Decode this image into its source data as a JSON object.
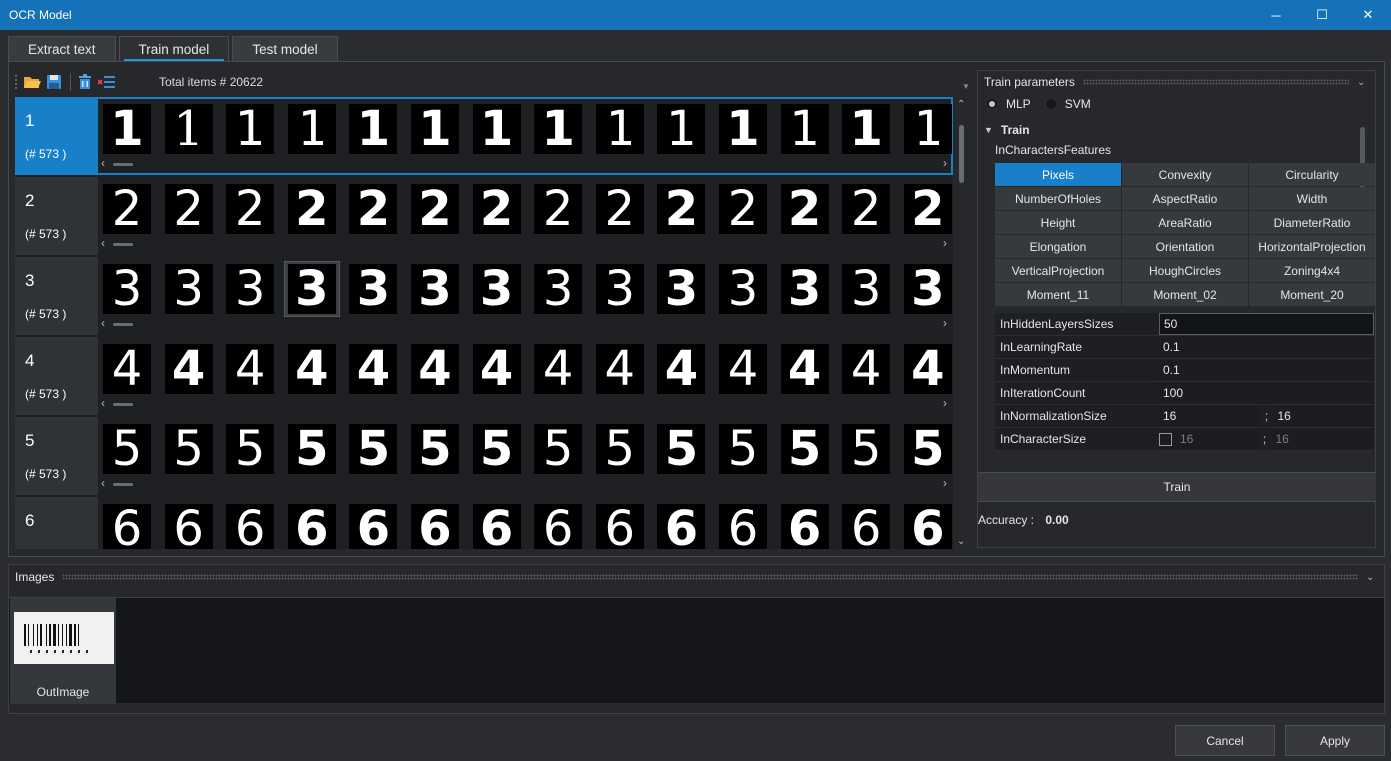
{
  "window": {
    "title": "OCR Model",
    "minimize_glyph": "─",
    "maximize_glyph": "☐",
    "close_glyph": "✕"
  },
  "tabs": [
    {
      "label": "Extract text",
      "active": false
    },
    {
      "label": "Train model",
      "active": true
    },
    {
      "label": "Test model",
      "active": false
    }
  ],
  "toolbar": {
    "icons": [
      "open-folder-icon",
      "save-icon",
      "delete-icon",
      "clear-list-icon"
    ],
    "total_label": "Total items # 20622"
  },
  "classes": [
    {
      "label": "1",
      "count": "(# 573 )",
      "selected": true,
      "styles": [
        "bold",
        "serif",
        "thin",
        "mono",
        "bold",
        "bold",
        "bold",
        "bold",
        "mono",
        "thin",
        "bold",
        "thin",
        "bold",
        "mono"
      ]
    },
    {
      "label": "2",
      "count": "(# 573 )",
      "selected": false,
      "styles": [
        "thin",
        "thin",
        "thin",
        "bold",
        "bold",
        "bold",
        "bold",
        "thin",
        "thin",
        "bold",
        "thin",
        "bold",
        "thin",
        "bold"
      ]
    },
    {
      "label": "3",
      "count": "(# 573 )",
      "selected": false,
      "styles": [
        "thin",
        "thin",
        "thin",
        "bold",
        "bold",
        "bold",
        "bold",
        "thin",
        "thin",
        "bold",
        "thin",
        "bold",
        "thin",
        "bold"
      ]
    },
    {
      "label": "4",
      "count": "(# 573 )",
      "selected": false,
      "styles": [
        "thin",
        "bold",
        "thin",
        "bold",
        "bold",
        "bold",
        "bold",
        "thin",
        "thin",
        "bold",
        "thin",
        "bold",
        "thin",
        "bold"
      ]
    },
    {
      "label": "5",
      "count": "(# 573 )",
      "selected": false,
      "styles": [
        "thin",
        "thin",
        "thin",
        "bold",
        "bold",
        "bold",
        "bold",
        "thin",
        "thin",
        "bold",
        "thin",
        "bold",
        "thin",
        "bold"
      ]
    },
    {
      "label": "6",
      "count": "",
      "selected": false,
      "styles": [
        "thin",
        "thin",
        "thin",
        "bold",
        "bold",
        "bold",
        "bold",
        "thin",
        "thin",
        "bold",
        "thin",
        "bold",
        "thin",
        "bold"
      ]
    }
  ],
  "highlighted_thumb": {
    "row": 2,
    "index": 3
  },
  "train_params": {
    "header": "Train parameters",
    "methods": [
      {
        "label": "MLP",
        "checked": true
      },
      {
        "label": "SVM",
        "checked": false
      }
    ],
    "section": "Train",
    "features_label": "InCharactersFeatures",
    "features": [
      {
        "label": "Pixels",
        "on": true
      },
      {
        "label": "Convexity",
        "on": false
      },
      {
        "label": "Circularity",
        "on": false
      },
      {
        "label": "NumberOfHoles",
        "on": false
      },
      {
        "label": "AspectRatio",
        "on": false
      },
      {
        "label": "Width",
        "on": false
      },
      {
        "label": "Height",
        "on": false
      },
      {
        "label": "AreaRatio",
        "on": false
      },
      {
        "label": "DiameterRatio",
        "on": false
      },
      {
        "label": "Elongation",
        "on": false
      },
      {
        "label": "Orientation",
        "on": false
      },
      {
        "label": "HorizontalProjection",
        "on": false
      },
      {
        "label": "VerticalProjection",
        "on": false
      },
      {
        "label": "HoughCircles",
        "on": false
      },
      {
        "label": "Zoning4x4",
        "on": false
      },
      {
        "label": "Moment_11",
        "on": false
      },
      {
        "label": "Moment_02",
        "on": false
      },
      {
        "label": "Moment_20",
        "on": false
      }
    ],
    "hidden_layers": {
      "name": "InHiddenLayersSizes",
      "value": "50"
    },
    "learning_rate": {
      "name": "InLearningRate",
      "value": "0.1"
    },
    "momentum": {
      "name": "InMomentum",
      "value": "0.1"
    },
    "iteration_count": {
      "name": "InIterationCount",
      "value": "100"
    },
    "normalization_size": {
      "name": "InNormalizationSize",
      "value_a": "16",
      "value_b": "16"
    },
    "character_size": {
      "name": "InCharacterSize",
      "checked": false,
      "value_a": "16",
      "value_b": "16"
    },
    "separator": ";",
    "train_button": "Train",
    "accuracy_label": "Accuracy :",
    "accuracy_value": "0.00"
  },
  "images_panel": {
    "header": "Images",
    "items": [
      {
        "caption": "OutImage"
      }
    ]
  },
  "footer": {
    "cancel": "Cancel",
    "apply": "Apply"
  }
}
